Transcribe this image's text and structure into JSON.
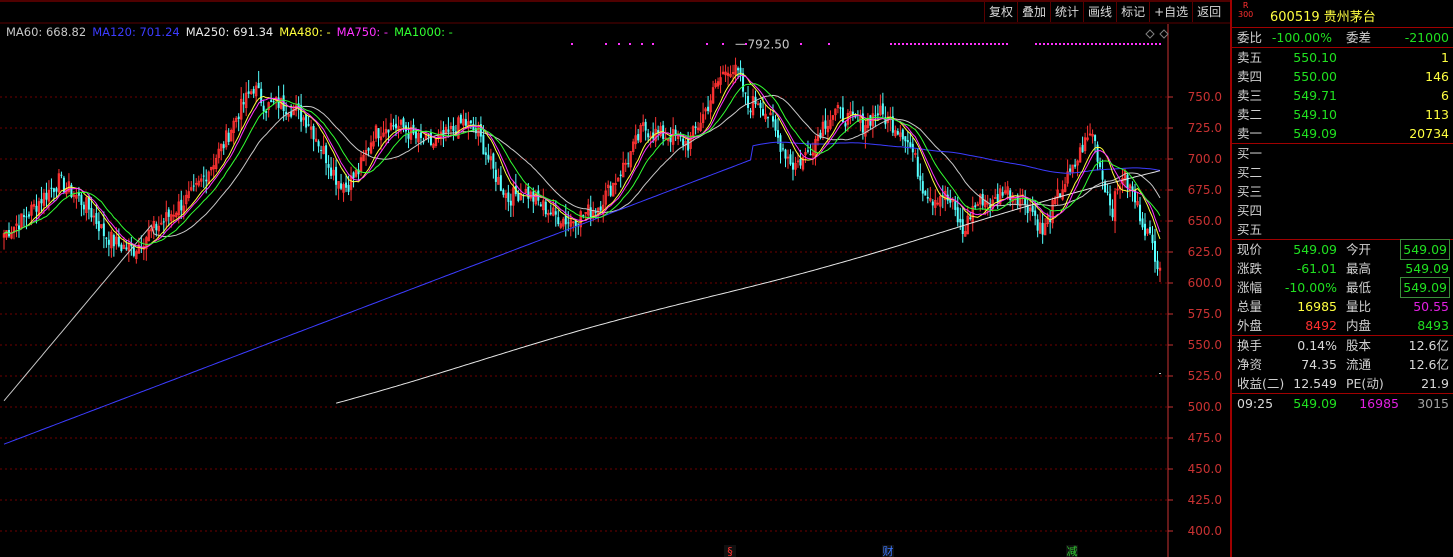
{
  "toolbar": [
    {
      "label": "复权"
    },
    {
      "label": "叠加"
    },
    {
      "label": "统计"
    },
    {
      "label": "画线"
    },
    {
      "label": "标记"
    },
    {
      "label": "+自选"
    },
    {
      "label": "返回"
    }
  ],
  "colors": {
    "up": "#ff3232",
    "down": "#54ffff",
    "axis": "#c83232",
    "ma60": "#c8c8c8",
    "ma120": "#3c3cff",
    "ma250": "#ffffff",
    "ma480": "#ffff3c",
    "ma750": "#ff32ff",
    "ma1000": "#32ff32",
    "grid": "#6e0000",
    "event_mark": "#ff32ff"
  },
  "ma_legend": [
    {
      "text": "MA60: 668.82",
      "color": "#c8c8c8"
    },
    {
      "text": "MA120: 701.24",
      "color": "#3c3cff"
    },
    {
      "text": "MA250: 691.34",
      "color": "#e8e8e8"
    },
    {
      "text": "MA480: -",
      "color": "#ffff3c"
    },
    {
      "text": "MA750: -",
      "color": "#ff32ff"
    },
    {
      "text": "MA1000: -",
      "color": "#32ff32"
    }
  ],
  "stock": {
    "tag": "R\n300",
    "code_name": "600519 贵州茅台"
  },
  "order_book": {
    "ratio_label": "委比",
    "ratio": "-100.00%",
    "diff_label": "委差",
    "diff": "-21000",
    "sells": [
      {
        "label": "卖五",
        "price": "550.10",
        "vol": "1"
      },
      {
        "label": "卖四",
        "price": "550.00",
        "vol": "146"
      },
      {
        "label": "卖三",
        "price": "549.71",
        "vol": "6"
      },
      {
        "label": "卖二",
        "price": "549.10",
        "vol": "113"
      },
      {
        "label": "卖一",
        "price": "549.09",
        "vol": "20734"
      }
    ],
    "buys": [
      {
        "label": "买一"
      },
      {
        "label": "买二"
      },
      {
        "label": "买三"
      },
      {
        "label": "买四"
      },
      {
        "label": "买五"
      }
    ]
  },
  "quote": [
    {
      "l1": "现价",
      "v1": "549.09",
      "c1": "green",
      "l2": "今开",
      "v2": "549.09",
      "c2": "green",
      "b2": true
    },
    {
      "l1": "涨跌",
      "v1": "-61.01",
      "c1": "green",
      "l2": "最高",
      "v2": "549.09",
      "c2": "green"
    },
    {
      "l1": "涨幅",
      "v1": "-10.00%",
      "c1": "green",
      "l2": "最低",
      "v2": "549.09",
      "c2": "green",
      "b2": true
    },
    {
      "l1": "总量",
      "v1": "16985",
      "c1": "yellow",
      "l2": "量比",
      "v2": "50.55",
      "c2": "magenta"
    },
    {
      "l1": "外盘",
      "v1": "8492",
      "c1": "red",
      "l2": "内盘",
      "v2": "8493",
      "c2": "green"
    }
  ],
  "fundamentals": [
    {
      "l1": "换手",
      "v1": "0.14%",
      "l2": "股本",
      "v2": "12.6亿"
    },
    {
      "l1": "净资",
      "v1": "74.35",
      "l2": "流通",
      "v2": "12.6亿"
    },
    {
      "l1": "收益(二)",
      "v1": "12.549",
      "l2": "PE(动)",
      "v2": "21.9"
    }
  ],
  "tick": {
    "time": "09:25",
    "price": "549.09",
    "vol": "16985",
    "count": "3015"
  },
  "chart_data": {
    "type": "candlestick",
    "y_ticks": [
      400,
      425,
      450,
      475,
      500,
      525,
      550,
      575,
      600,
      625,
      650,
      675,
      700,
      725,
      750
    ],
    "ylim": [
      390,
      810
    ],
    "peak_annotation": {
      "text": "792.50",
      "value": 792.5
    },
    "event_markers": [
      {
        "label": "§",
        "color": "#ff3232"
      },
      {
        "label": "财",
        "color": "#3c78ff"
      },
      {
        "label": "减",
        "color": "#32c832"
      }
    ],
    "anchors": [
      [
        0,
        640
      ],
      [
        8,
        652
      ],
      [
        15,
        668
      ],
      [
        22,
        682
      ],
      [
        28,
        672
      ],
      [
        34,
        660
      ],
      [
        40,
        640
      ],
      [
        46,
        630
      ],
      [
        52,
        627
      ],
      [
        58,
        640
      ],
      [
        64,
        650
      ],
      [
        70,
        662
      ],
      [
        76,
        672
      ],
      [
        82,
        692
      ],
      [
        88,
        712
      ],
      [
        94,
        738
      ],
      [
        100,
        758
      ],
      [
        105,
        742
      ],
      [
        110,
        745
      ],
      [
        116,
        740
      ],
      [
        122,
        730
      ],
      [
        128,
        706
      ],
      [
        133,
        685
      ],
      [
        137,
        678
      ],
      [
        142,
        690
      ],
      [
        148,
        720
      ],
      [
        154,
        728
      ],
      [
        160,
        725
      ],
      [
        166,
        715
      ],
      [
        172,
        712
      ],
      [
        178,
        720
      ],
      [
        184,
        730
      ],
      [
        190,
        720
      ],
      [
        196,
        690
      ],
      [
        202,
        668
      ],
      [
        208,
        675
      ],
      [
        214,
        665
      ],
      [
        220,
        655
      ],
      [
        226,
        650
      ],
      [
        232,
        655
      ],
      [
        238,
        662
      ],
      [
        244,
        680
      ],
      [
        250,
        700
      ],
      [
        256,
        725
      ],
      [
        262,
        720
      ],
      [
        268,
        718
      ],
      [
        274,
        712
      ],
      [
        280,
        735
      ],
      [
        286,
        762
      ],
      [
        290,
        775
      ],
      [
        294,
        768
      ],
      [
        298,
        742
      ],
      [
        302,
        748
      ],
      [
        306,
        735
      ],
      [
        311,
        712
      ],
      [
        316,
        695
      ],
      [
        320,
        700
      ],
      [
        324,
        712
      ],
      [
        328,
        728
      ],
      [
        333,
        738
      ],
      [
        338,
        732
      ],
      [
        344,
        728
      ],
      [
        350,
        738
      ],
      [
        356,
        728
      ],
      [
        360,
        722
      ],
      [
        364,
        705
      ],
      [
        368,
        678
      ],
      [
        372,
        668
      ],
      [
        376,
        672
      ],
      [
        380,
        662
      ],
      [
        384,
        640
      ],
      [
        388,
        660
      ],
      [
        392,
        668
      ],
      [
        396,
        663
      ],
      [
        400,
        676
      ],
      [
        404,
        672
      ],
      [
        408,
        668
      ],
      [
        412,
        658
      ],
      [
        416,
        640
      ],
      [
        420,
        660
      ],
      [
        424,
        678
      ],
      [
        428,
        690
      ],
      [
        432,
        710
      ],
      [
        436,
        722
      ],
      [
        440,
        685
      ],
      [
        444,
        660
      ],
      [
        448,
        688
      ],
      [
        452,
        672
      ],
      [
        456,
        650
      ],
      [
        460,
        630
      ],
      [
        463,
        612
      ]
    ],
    "ma_overlays": [
      {
        "name": "MA60",
        "color": "#c8c8c8",
        "start": 0,
        "window": 30
      },
      {
        "name": "MA120",
        "color": "#3c3cff",
        "start": 0,
        "window": 60
      },
      {
        "name": "MA250",
        "color": "#e8e8e8",
        "start": 133,
        "window": 125
      },
      {
        "name": "MA480",
        "color": "#ffff3c",
        "start": 0,
        "window": 10
      },
      {
        "name": "MA750",
        "color": "#ff32ff",
        "start": 0,
        "window": 12
      },
      {
        "name": "MA1000",
        "color": "#32ff32",
        "start": 0,
        "window": 18
      }
    ]
  }
}
